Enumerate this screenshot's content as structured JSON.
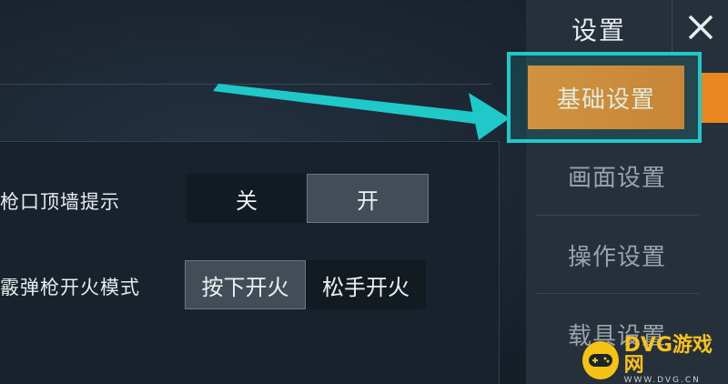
{
  "sidebar": {
    "title": "设置",
    "close_icon": "close-icon",
    "items": [
      {
        "label": "基础设置",
        "active": true
      },
      {
        "label": "画面设置",
        "active": false
      },
      {
        "label": "操作设置",
        "active": false
      },
      {
        "label": "载具设置",
        "active": false
      }
    ]
  },
  "settings": [
    {
      "label": "枪口顶墙提示",
      "options": [
        "关",
        "开"
      ],
      "selected": "开"
    },
    {
      "label": "霰弹枪开火模式",
      "options": [
        "按下开火",
        "松手开火"
      ],
      "selected": "按下开火"
    }
  ],
  "annotation": {
    "arrow_color": "#1fc9c9",
    "highlight_color": "#1fc9c9"
  },
  "accent_color": "#e9861f",
  "watermark": {
    "brand": "DVG游戏网",
    "url": "WWW.DVG.CN"
  }
}
